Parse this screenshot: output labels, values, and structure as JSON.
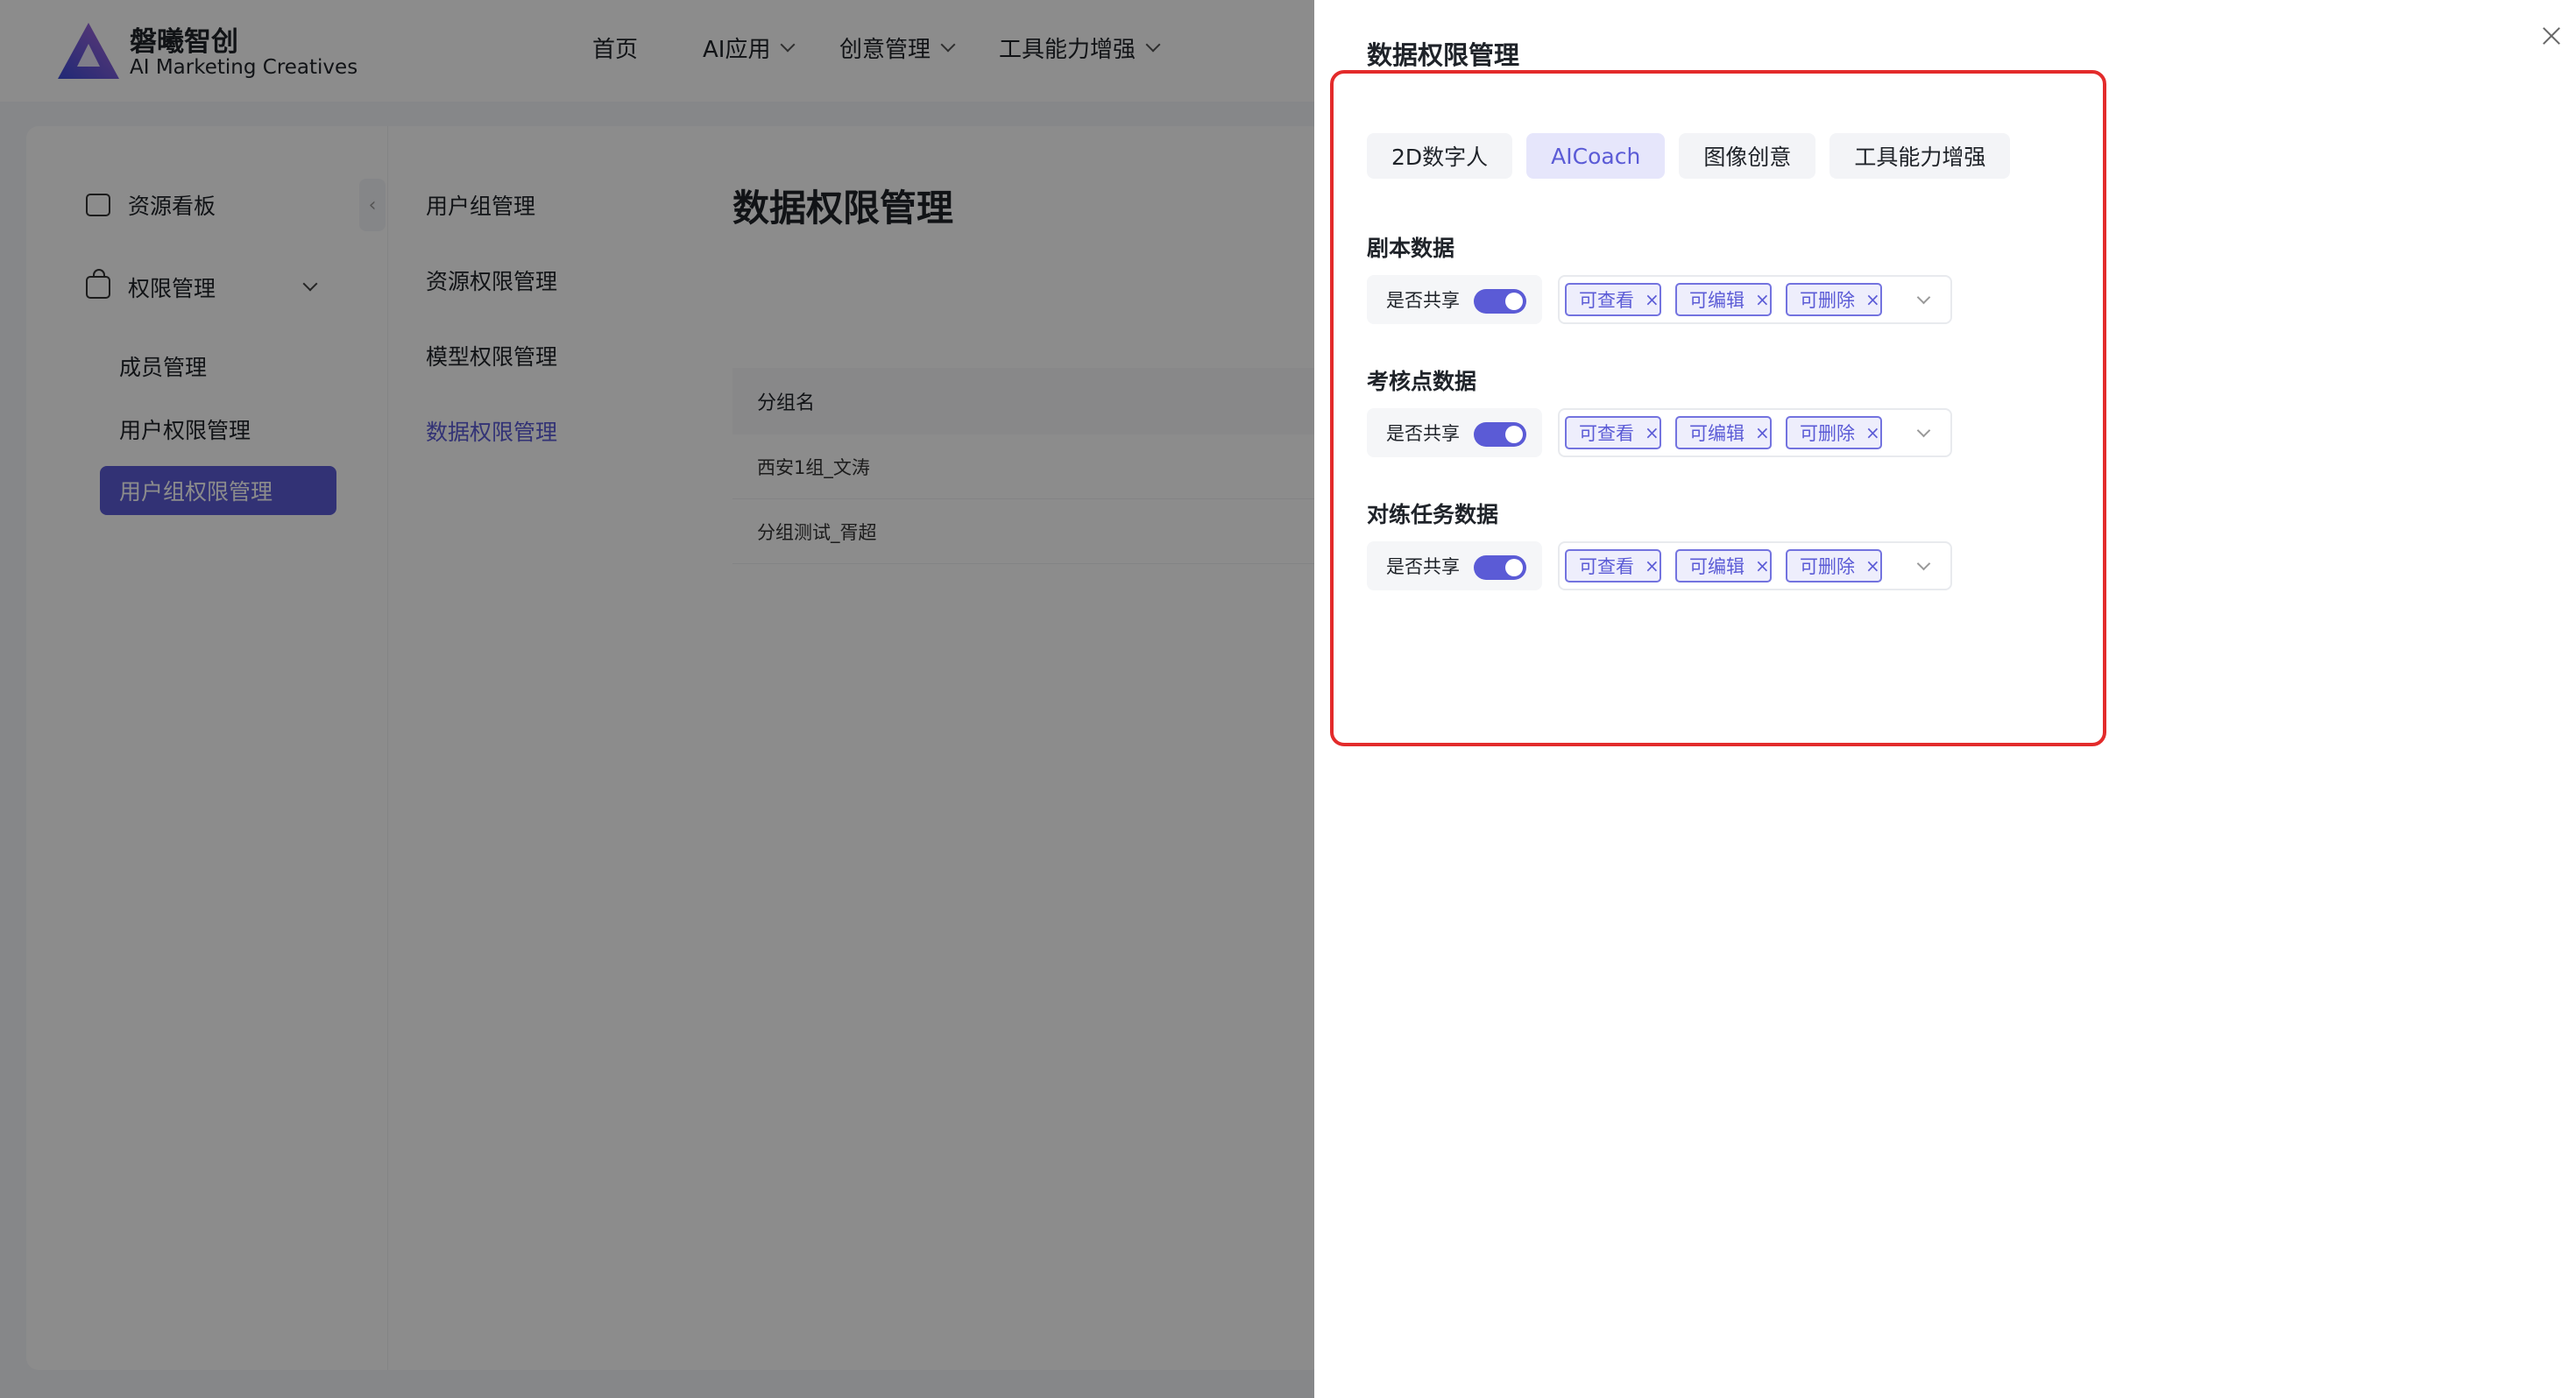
{
  "header": {
    "brand_name": "磐曦智创",
    "brand_sub": "AI Marketing Creatives",
    "nav": [
      "首页",
      "AI应用",
      "创意管理",
      "工具能力增强"
    ]
  },
  "sidebar": {
    "items": [
      "资源看板",
      "权限管理"
    ],
    "sub_items": [
      "成员管理",
      "用户权限管理",
      "用户组权限管理"
    ]
  },
  "sub_nav": {
    "items": [
      "用户组管理",
      "资源权限管理",
      "模型权限管理",
      "数据权限管理"
    ]
  },
  "main": {
    "title": "数据权限管理",
    "table_header": "分组名",
    "rows": [
      "西安1组_文涛",
      "分组测试_胥超"
    ]
  },
  "drawer": {
    "title": "数据权限管理",
    "tabs": [
      "2D数字人",
      "AICoach",
      "图像创意",
      "工具能力增强"
    ],
    "active_tab": "AICoach",
    "share_label": "是否共享",
    "sections": [
      {
        "title": "剧本数据",
        "shared": true,
        "tags": [
          "可查看",
          "可编辑",
          "可删除"
        ]
      },
      {
        "title": "考核点数据",
        "shared": true,
        "tags": [
          "可查看",
          "可编辑",
          "可删除"
        ]
      },
      {
        "title": "对练任务数据",
        "shared": true,
        "tags": [
          "可查看",
          "可编辑",
          "可删除"
        ]
      }
    ],
    "tag_remove_glyph": "×"
  },
  "colors": {
    "accent": "#5b5bd6",
    "highlight": "#e32b2b"
  }
}
